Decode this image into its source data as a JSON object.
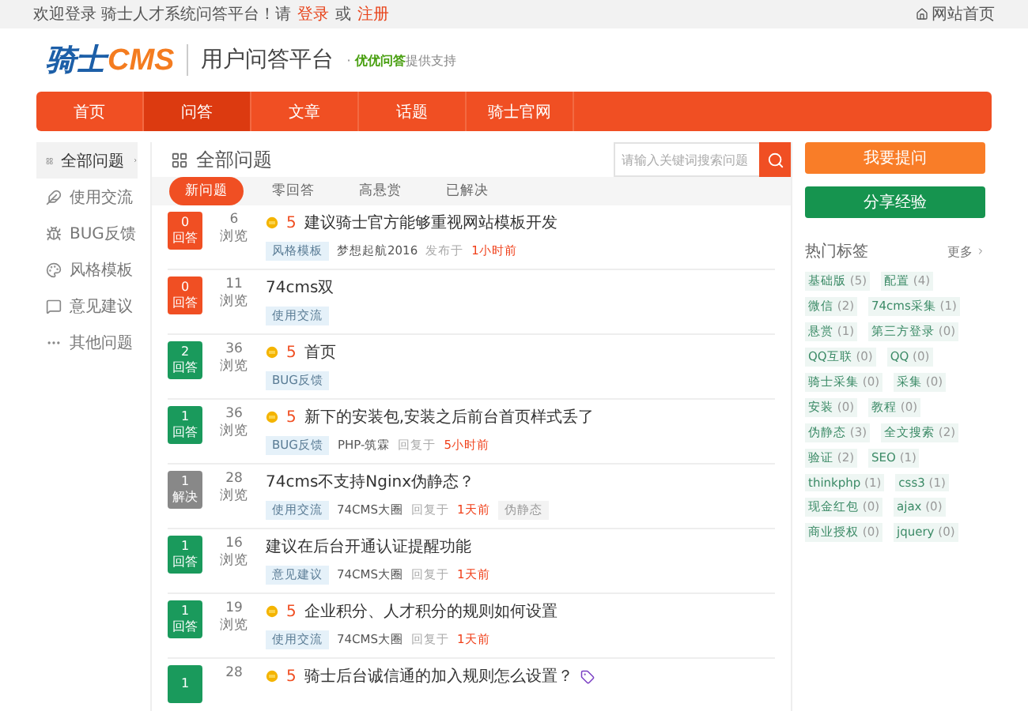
{
  "top_bar": {
    "welcome": "欢迎登录 骑士人才系统问答平台！请",
    "login": "登录",
    "or": "或",
    "register": "注册",
    "home_link": "网站首页"
  },
  "header": {
    "logo_main": "骑士",
    "logo_accent": "CMS",
    "title": "用户问答平台",
    "separator": "·",
    "sponsor": "优优问答",
    "sponsor_suffix": "提供支持"
  },
  "nav": [
    {
      "label": "首页",
      "selected": false
    },
    {
      "label": "问答",
      "selected": true
    },
    {
      "label": "文章",
      "selected": false
    },
    {
      "label": "话题",
      "selected": false
    },
    {
      "label": "骑士官网",
      "selected": false
    }
  ],
  "sidebar": [
    {
      "label": "全部问题",
      "selected": true
    },
    {
      "label": "使用交流",
      "selected": false
    },
    {
      "label": "BUG反馈",
      "selected": false
    },
    {
      "label": "风格模板",
      "selected": false
    },
    {
      "label": "意见建议",
      "selected": false
    },
    {
      "label": "其他问题",
      "selected": false
    }
  ],
  "main": {
    "title": "全部问题",
    "search": {
      "placeholder": "请输入关键词搜索问题"
    },
    "filters": [
      {
        "label": "新问题",
        "selected": true
      },
      {
        "label": "零回答",
        "selected": false
      },
      {
        "label": "高悬赏",
        "selected": false
      },
      {
        "label": "已解决",
        "selected": false
      }
    ],
    "questions": [
      {
        "count": "0",
        "kind": "unanswered",
        "status_label": "回答",
        "views": "6",
        "views_label": "浏览",
        "reward": "5",
        "title": "建议骑士官方能够重视网站模板开发",
        "tag": "风格模板",
        "author": "梦想起航2016",
        "action": "发布于",
        "time": "1小时前"
      },
      {
        "count": "0",
        "kind": "unanswered",
        "status_label": "回答",
        "views": "11",
        "views_label": "浏览",
        "title": "74cms双",
        "tag": "使用交流"
      },
      {
        "count": "2",
        "kind": "answered",
        "status_label": "回答",
        "views": "36",
        "views_label": "浏览",
        "reward": "5",
        "title": "首页",
        "tag": "BUG反馈"
      },
      {
        "count": "1",
        "kind": "answered",
        "status_label": "回答",
        "views": "36",
        "views_label": "浏览",
        "reward": "5",
        "title": "新下的安装包,安装之后前台首页样式丢了",
        "tag": "BUG反馈",
        "author": "PHP-筑霖",
        "action": "回复于",
        "time": "5小时前"
      },
      {
        "count": "1",
        "kind": "solved",
        "status_label": "解决",
        "views": "28",
        "views_label": "浏览",
        "title": "74cms不支持Nginx伪静态？",
        "tag": "使用交流",
        "author": "74CMS大圈",
        "action": "回复于",
        "time": "1天前",
        "extra_tag": "伪静态"
      },
      {
        "count": "1",
        "kind": "answered",
        "status_label": "回答",
        "views": "16",
        "views_label": "浏览",
        "title": "建议在后台开通认证提醒功能",
        "tag": "意见建议",
        "author": "74CMS大圈",
        "action": "回复于",
        "time": "1天前"
      },
      {
        "count": "1",
        "kind": "answered",
        "status_label": "回答",
        "views": "19",
        "views_label": "浏览",
        "reward": "5",
        "title": "企业积分、人才积分的规则如何设置",
        "tag": "使用交流",
        "author": "74CMS大圈",
        "action": "回复于",
        "time": "1天前"
      },
      {
        "count": "1",
        "kind": "answered",
        "views": "28",
        "reward": "5",
        "title": "骑士后台诚信通的加入规则怎么设置？",
        "badge": true
      }
    ]
  },
  "aside": {
    "buttons": [
      {
        "label": "我要提问",
        "kind": "ask"
      },
      {
        "label": "分享经验",
        "kind": "share"
      }
    ],
    "hot_tags_title": "热门标签",
    "more": "更多",
    "tags": [
      {
        "name": "基础版",
        "count": "(5)"
      },
      {
        "name": "配置",
        "count": "(4)"
      },
      {
        "name": "微信",
        "count": "(2)"
      },
      {
        "name": "74cms采集",
        "count": "(1)"
      },
      {
        "name": "悬赏",
        "count": "(1)"
      },
      {
        "name": "第三方登录",
        "count": "(0)"
      },
      {
        "name": "QQ互联",
        "count": "(0)"
      },
      {
        "name": "QQ",
        "count": "(0)"
      },
      {
        "name": "骑士采集",
        "count": "(0)"
      },
      {
        "name": "采集",
        "count": "(0)"
      },
      {
        "name": "安装",
        "count": "(0)"
      },
      {
        "name": "教程",
        "count": "(0)"
      },
      {
        "name": "伪静态",
        "count": "(3)"
      },
      {
        "name": "全文搜索",
        "count": "(2)"
      },
      {
        "name": "验证",
        "count": "(2)"
      },
      {
        "name": "SEO",
        "count": "(1)"
      },
      {
        "name": "thinkphp",
        "count": "(1)"
      },
      {
        "name": "css3",
        "count": "(1)"
      },
      {
        "name": "现金红包",
        "count": "(0)"
      },
      {
        "name": "ajax",
        "count": "(0)"
      },
      {
        "name": "商业授权",
        "count": "(0)"
      },
      {
        "name": "jquery",
        "count": "(0)"
      }
    ]
  }
}
